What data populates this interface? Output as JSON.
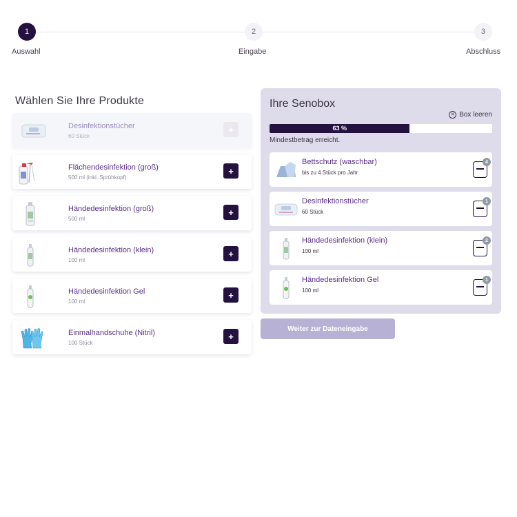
{
  "stepper": {
    "steps": [
      {
        "number": "1",
        "label": "Auswahl"
      },
      {
        "number": "2",
        "label": "Eingabe"
      },
      {
        "number": "3",
        "label": "Abschluss"
      }
    ],
    "active_step": 1
  },
  "products": {
    "title": "Wählen Sie Ihre Produkte",
    "items": [
      {
        "name": "Desinfektionstücher",
        "sub": "60 Stück",
        "add_label": "+",
        "icon": "wipes-pack"
      },
      {
        "name": "Flächendesinfektion (groß)",
        "sub": "500 ml (inkl. Sprühkopf)",
        "add_label": "+",
        "icon": "spray-bottle"
      },
      {
        "name": "Händedesinfektion (groß)",
        "sub": "500 ml",
        "add_label": "+",
        "icon": "pump-bottle"
      },
      {
        "name": "Händedesinfektion (klein)",
        "sub": "100 ml",
        "add_label": "+",
        "icon": "small-bottle"
      },
      {
        "name": "Händedesinfektion Gel",
        "sub": "100 ml",
        "add_label": "+",
        "icon": "gel-bottle"
      },
      {
        "name": "Einmalhandschuhe (Nitril)",
        "sub": "100 Stück",
        "add_label": "+",
        "icon": "gloves"
      }
    ]
  },
  "box": {
    "title": "Ihre Senobox",
    "empty_label": "Box leeren",
    "progress_percent": 63,
    "progress_text": "63 %",
    "min_text": "Mindestbetrag erreicht.",
    "items": [
      {
        "name": "Bettschutz (waschbar)",
        "sub": "bis zu 4 Stück pro Jahr",
        "qty": "4",
        "icon": "bed-pad"
      },
      {
        "name": "Desinfektionstücher",
        "sub": "60 Stück",
        "qty": "1",
        "icon": "wipes-pack"
      },
      {
        "name": "Händedesinfektion (klein)",
        "sub": "100 ml",
        "qty": "2",
        "icon": "small-bottle"
      },
      {
        "name": "Händedesinfektion Gel",
        "sub": "100 ml",
        "qty": "1",
        "icon": "gel-bottle"
      }
    ]
  },
  "next_button": {
    "label": "Weiter zur Dateneingabe"
  },
  "colors": {
    "accent": "#24113f",
    "panel": "#dedbeb",
    "product_name": "#5c2e86",
    "disabled_button": "#b7b1d6"
  }
}
